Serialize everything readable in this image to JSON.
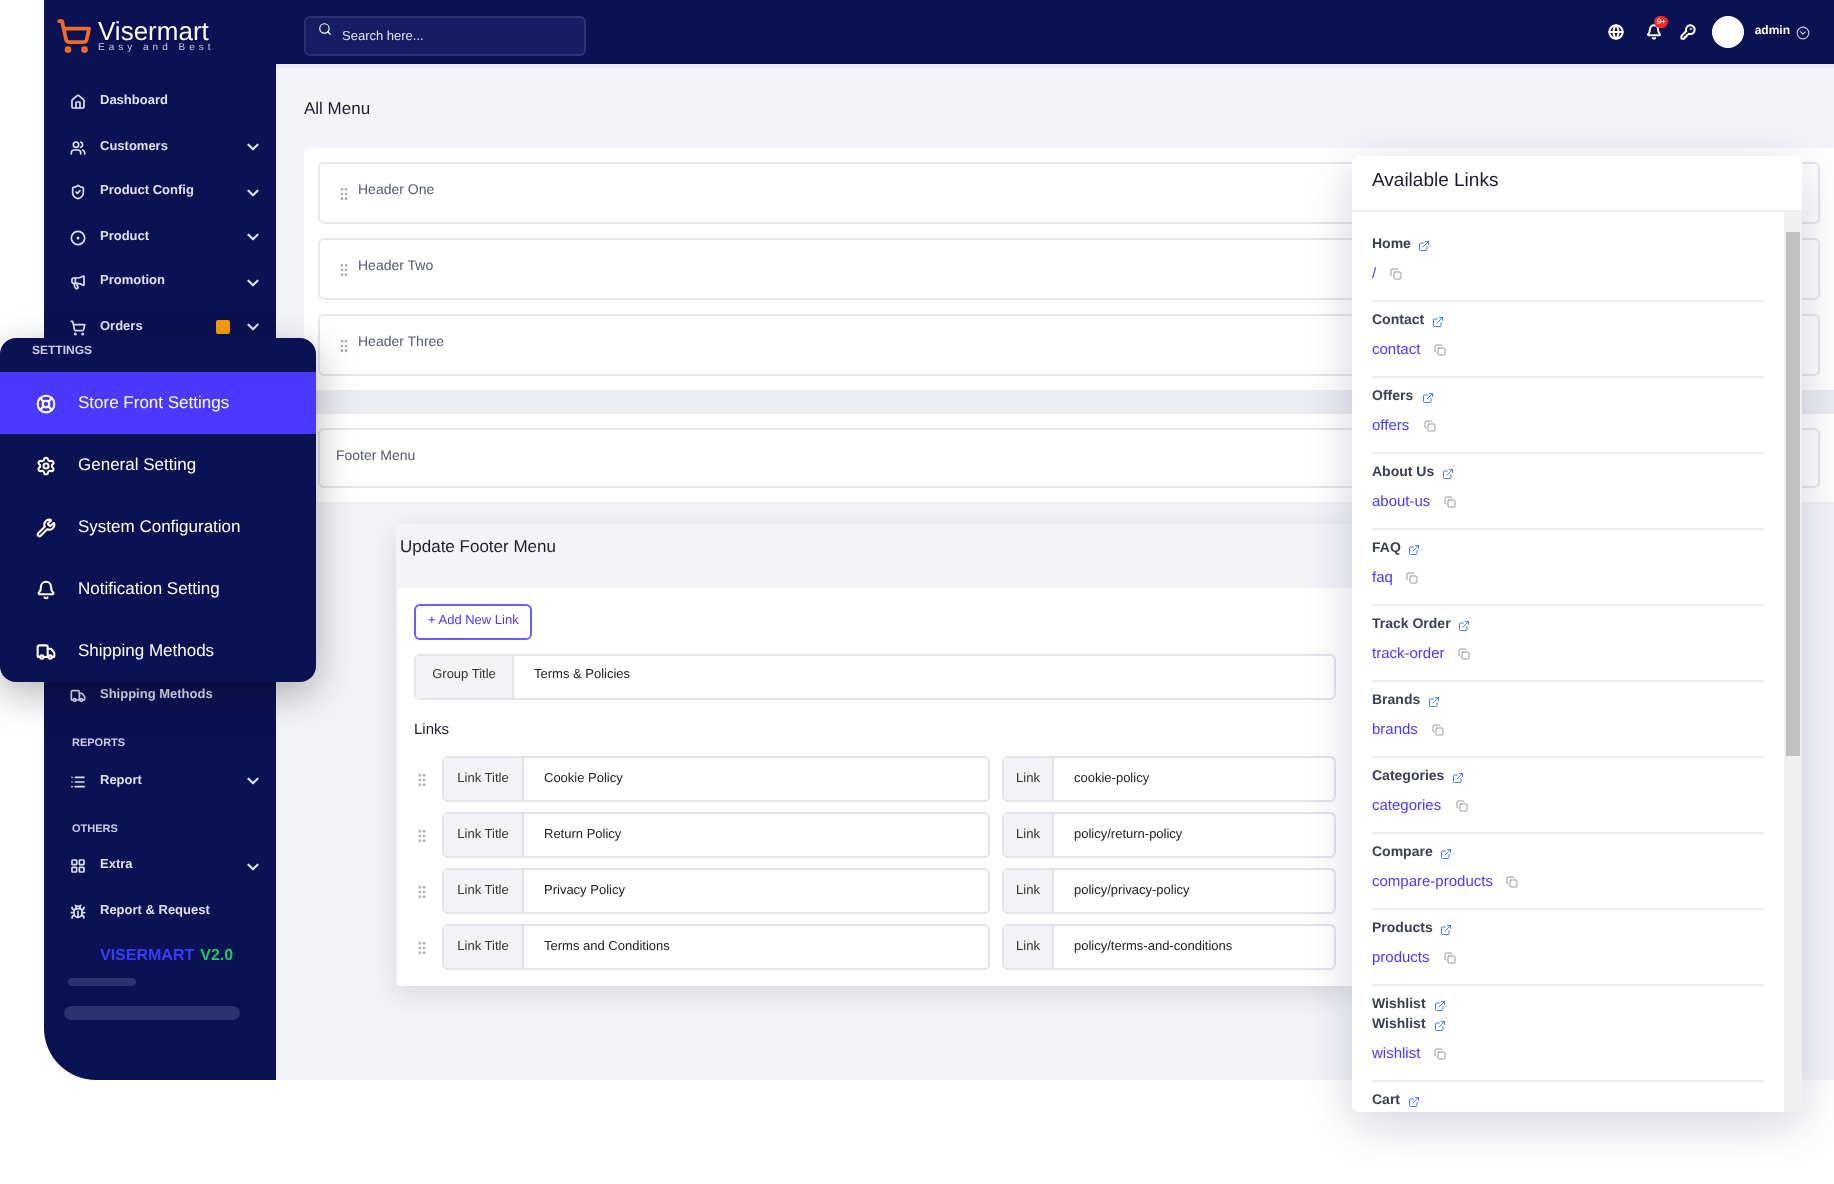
{
  "brand": {
    "name": "Visermart",
    "tagline": "Easy and Best"
  },
  "topbar": {
    "search": {
      "placeholder": "Search here..."
    },
    "notification_count": "9+",
    "user": "admin"
  },
  "sidebar": {
    "items": [
      {
        "kind": "item",
        "label": "Dashboard",
        "expandable": false
      },
      {
        "kind": "item",
        "label": "Customers",
        "expandable": true
      },
      {
        "kind": "item",
        "label": "Product Config",
        "expandable": true
      },
      {
        "kind": "item",
        "label": "Product",
        "expandable": true
      },
      {
        "kind": "item",
        "label": "Promotion",
        "expandable": true
      },
      {
        "kind": "item",
        "label": "Orders",
        "expandable": true,
        "badge": true
      },
      {
        "kind": "gap"
      },
      {
        "kind": "item",
        "label": "Shipping Methods",
        "expandable": false
      },
      {
        "kind": "section",
        "label": "REPORTS"
      },
      {
        "kind": "item",
        "label": "Report",
        "expandable": true
      },
      {
        "kind": "section",
        "label": "OTHERS"
      },
      {
        "kind": "item",
        "label": "Extra",
        "expandable": true
      },
      {
        "kind": "item",
        "label": "Report & Request",
        "expandable": false
      },
      {
        "kind": "version",
        "name": "VISERMART",
        "version": "V2.0"
      }
    ]
  },
  "settings_popup": {
    "title": "SETTINGS",
    "items": [
      {
        "label": "Store Front Settings",
        "selected": true
      },
      {
        "label": "General Setting",
        "selected": false
      },
      {
        "label": "System Configuration",
        "selected": false
      },
      {
        "label": "Notification Setting",
        "selected": false
      },
      {
        "label": "Shipping Methods",
        "selected": false
      }
    ]
  },
  "page_title": "All Menu",
  "header_menus": [
    "Header One",
    "Header Two",
    "Header Three"
  ],
  "footer_menu": "Footer Menu",
  "update_panel": {
    "title": "Update Footer Menu",
    "add_button": "+ Add New Link",
    "group_title_label": "Group Title",
    "group_title": "Terms & Policies",
    "links_label": "Links",
    "links": [
      {
        "title_label": "Link Title",
        "title": "Cookie Policy",
        "link_label": "Link",
        "link": "cookie-policy"
      },
      {
        "title_label": "Link Title",
        "title": "Return Policy",
        "link_label": "Link",
        "link": "policy/return-policy"
      },
      {
        "title_label": "Link Title",
        "title": "Privacy Policy",
        "link_label": "Link",
        "link": "policy/privacy-policy"
      },
      {
        "title_label": "Link Title",
        "title": "Terms and Conditions",
        "link_label": "Link",
        "link": "policy/terms-and-conditions"
      }
    ]
  },
  "available_links": {
    "title": "Available Links",
    "items": [
      {
        "titles": [
          "Home"
        ],
        "slug": "/"
      },
      {
        "titles": [
          "Contact"
        ],
        "slug": "contact"
      },
      {
        "titles": [
          "Offers"
        ],
        "slug": "offers"
      },
      {
        "titles": [
          "About Us"
        ],
        "slug": "about-us"
      },
      {
        "titles": [
          "FAQ"
        ],
        "slug": "faq"
      },
      {
        "titles": [
          "Track Order"
        ],
        "slug": "track-order"
      },
      {
        "titles": [
          "Brands"
        ],
        "slug": "brands"
      },
      {
        "titles": [
          "Categories"
        ],
        "slug": "categories"
      },
      {
        "titles": [
          "Compare"
        ],
        "slug": "compare-products"
      },
      {
        "titles": [
          "Products"
        ],
        "slug": "products"
      },
      {
        "titles": [
          "Wishlist",
          "Wishlist"
        ],
        "slug": "wishlist"
      },
      {
        "titles": [
          "Cart"
        ]
      }
    ]
  }
}
